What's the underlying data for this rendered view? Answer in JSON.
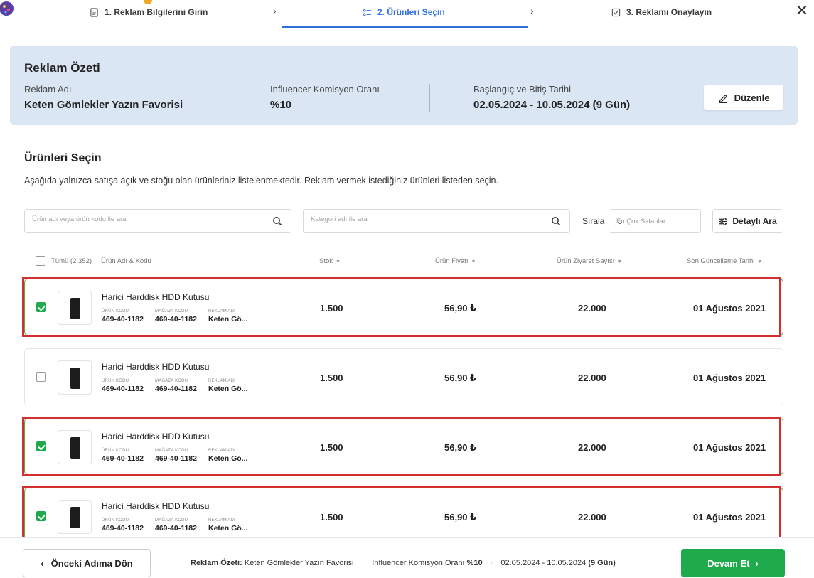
{
  "stepper": {
    "steps": [
      {
        "label": "1. Reklam Bilgilerini Girin"
      },
      {
        "label": "2. Ürünleri Seçin"
      },
      {
        "label": "3. Reklamı Onaylayın"
      }
    ],
    "separator": "›",
    "close": "✕"
  },
  "summary": {
    "title": "Reklam Özeti",
    "ad_name_label": "Reklam Adı",
    "ad_name": "Keten Gömlekler Yazın Favorisi",
    "commission_label": "Influencer Komisyon Oranı",
    "commission": "%10",
    "date_label": "Başlangıç ve Bitiş Tarihi",
    "date": "02.05.2024 - 10.05.2024 (9 Gün)",
    "edit_label": "Düzenle"
  },
  "products": {
    "title": "Ürünleri Seçin",
    "description": "Aşağıda yalnızca satışa açık ve stoğu olan ürünleriniz listelenmektedir. Reklam vermek istediğiniz ürünleri listeden seçin.",
    "search_placeholder": "Ürün adı veya ürün kodu ile ara",
    "category_placeholder": "Kategori adı ile ara",
    "sort_label": "Sırala",
    "sort_value": "En Çok Satanlar",
    "detail_label": "Detaylı Ara",
    "columns": {
      "all": "Tümü (2.352)",
      "name": "Ürün Adı & Kodu",
      "stock": "Stok",
      "price": "Ürün Fiyatı",
      "visits": "Ürün Ziyaret Sayısı",
      "updated": "Son Güncelleme Tarihi"
    },
    "meta_labels": {
      "product_code": "ÜRÜN KODU",
      "store_code": "MAĞAZA KODU",
      "ad_name": "REKLAM ADI"
    },
    "rows": [
      {
        "selected": true,
        "name": "Harici Harddisk HDD Kutusu",
        "product_code": "469-40-1182",
        "store_code": "469-40-1182",
        "ad_name": "Keten Gö...",
        "stock": "1.500",
        "price": "56,90 ₺",
        "visits": "22.000",
        "updated": "01 Ağustos 2021"
      },
      {
        "selected": false,
        "name": "Harici Harddisk HDD Kutusu",
        "product_code": "469-40-1182",
        "store_code": "469-40-1182",
        "ad_name": "Keten Gö...",
        "stock": "1.500",
        "price": "56,90 ₺",
        "visits": "22.000",
        "updated": "01 Ağustos 2021"
      },
      {
        "selected": true,
        "name": "Harici Harddisk HDD Kutusu",
        "product_code": "469-40-1182",
        "store_code": "469-40-1182",
        "ad_name": "Keten Gö...",
        "stock": "1.500",
        "price": "56,90 ₺",
        "visits": "22.000",
        "updated": "01 Ağustos 2021"
      },
      {
        "selected": true,
        "name": "Harici Harddisk HDD Kutusu",
        "product_code": "469-40-1182",
        "store_code": "469-40-1182",
        "ad_name": "Keten Gö...",
        "stock": "1.500",
        "price": "56,90 ₺",
        "visits": "22.000",
        "updated": "01 Ağustos 2021"
      }
    ]
  },
  "footer": {
    "back_label": "Önceki Adıma Dön",
    "summary_label": "Reklam Özeti:",
    "summary_name": "Keten Gömlekler Yazın Favorisi",
    "commission_label": "Influencer Komisyon Oranı",
    "commission": "%10",
    "date_range": "02.05.2024 - 10.05.2024",
    "duration": "(9 Gün)",
    "next_label": "Devam Et"
  },
  "colors": {
    "accent_blue": "#2f6fe0",
    "success_green": "#1faa4b",
    "highlight_red": "#d32f2f",
    "summary_bg": "#dbe6f5"
  }
}
